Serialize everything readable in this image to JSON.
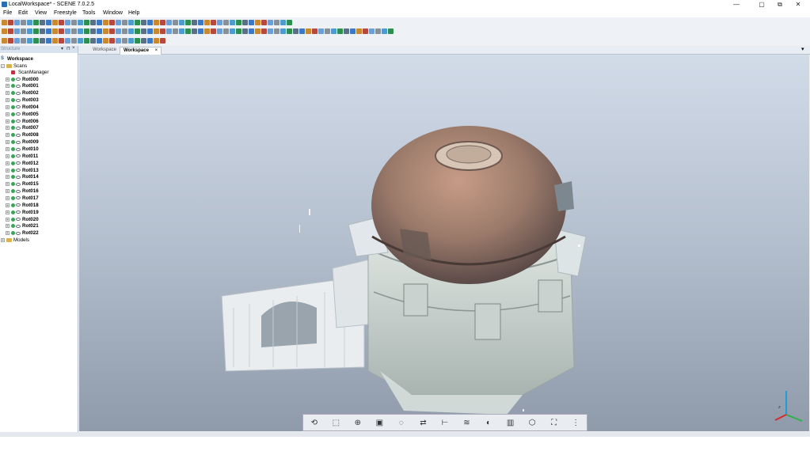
{
  "window": {
    "title": "LocalWorkspace* - SCENE 7.0.2.5",
    "controls": [
      "—",
      "▢",
      "⧉",
      "✕"
    ]
  },
  "menu": [
    "File",
    "Edit",
    "View",
    "Freestyle",
    "Tools",
    "Window",
    "Help"
  ],
  "structure_panel": {
    "title": "Structure"
  },
  "tree": {
    "workspace": "Workspace",
    "scans": "Scans",
    "scan_manager": "ScanManager",
    "scans_list": [
      "Rot000",
      "Rot001",
      "Rot002",
      "Rot003",
      "Rot004",
      "Rot005",
      "Rot006",
      "Rot007",
      "Rot008",
      "Rot009",
      "Rot010",
      "Rot011",
      "Rot012",
      "Rot013",
      "Rot014",
      "Rot015",
      "Rot016",
      "Rot017",
      "Rot018",
      "Rot019",
      "Rot020",
      "Rot021",
      "Rot022"
    ],
    "models": "Models"
  },
  "tabs": [
    "Workspace",
    "Workspace"
  ],
  "tab_close": "×",
  "nav_icons": [
    "view-mode-icon",
    "orbit-icon",
    "zoom-icon",
    "cube-view-icon",
    "rotate-icon",
    "walk-icon",
    "measure-icon",
    "layers-icon",
    "clip-icon",
    "split-icon",
    "box-icon",
    "fullscreen-icon",
    "grid-menu-icon"
  ],
  "colors": {
    "viewport_top": "#d2dbe8",
    "viewport_bottom": "#8f9aaa",
    "accent": "#2a6fb5"
  }
}
